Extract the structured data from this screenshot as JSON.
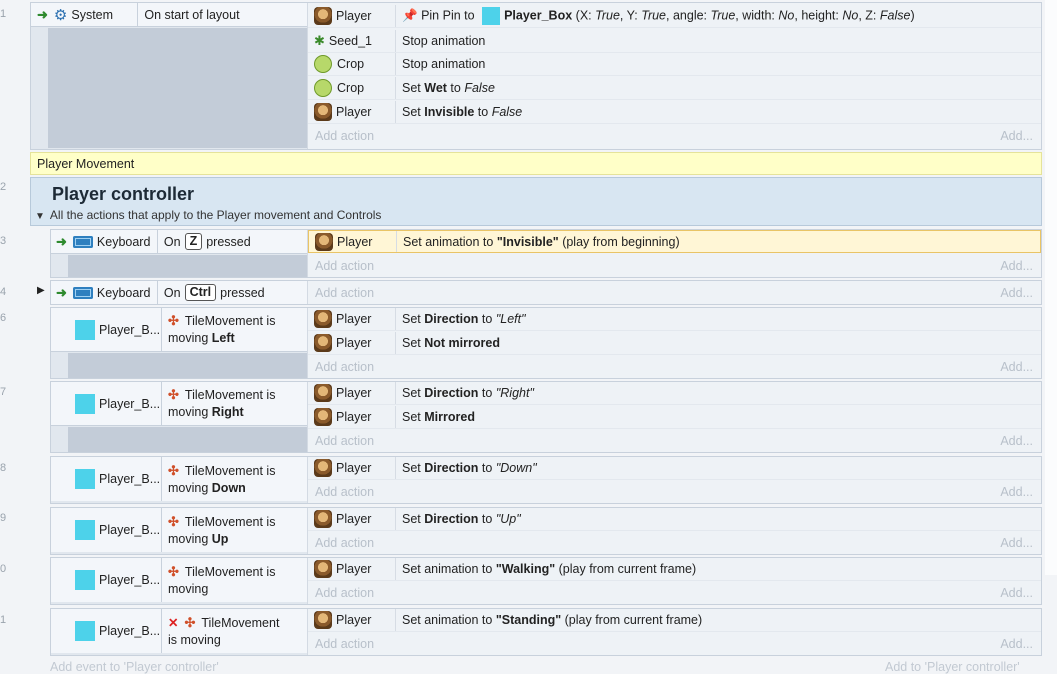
{
  "events": {
    "e1": {
      "line": "1",
      "condition": {
        "object": "System",
        "text": "On start of layout",
        "icon": "gear-icon"
      },
      "actions": [
        {
          "object": "Player",
          "icon": "player-icon",
          "text": "Pin Pin to",
          "target": "Player_Box",
          "params": {
            "open": "(X:",
            "x": "True",
            "y_label": ", Y:",
            "y": "True",
            "angle_label": ", angle:",
            "angle": "True",
            "width_label": ", width:",
            "width": "No",
            "height_label": ", height:",
            "height": "No",
            "z_label": ", Z:",
            "z": "False",
            "close": ")"
          }
        },
        {
          "object": "Seed_1",
          "icon": "seed-icon",
          "text": "Stop animation"
        },
        {
          "object": "Crop",
          "icon": "crop-icon",
          "text": "Stop animation"
        },
        {
          "object": "Crop",
          "icon": "crop-icon",
          "pre": "Set",
          "bold": "Wet",
          "mid": "to",
          "ital": "False"
        },
        {
          "object": "Player",
          "icon": "player-icon",
          "pre": "Set",
          "bold": "Invisible",
          "mid": "to",
          "ital": "False"
        }
      ]
    },
    "comment": "Player Movement",
    "group": {
      "line": "2",
      "title": "Player controller",
      "description": "All the actions that apply to the Player movement and Controls"
    },
    "e3": {
      "line": "3",
      "object": "Keyboard",
      "on": "On",
      "key": "Z",
      "post": "pressed",
      "action_object": "Player",
      "pre": "Set animation to",
      "bold": "\"Invisible\"",
      "post_text": "(play from beginning)"
    },
    "e4": {
      "line": "4",
      "object": "Keyboard",
      "on": "On",
      "key": "Ctrl",
      "post": "pressed"
    },
    "e6": {
      "line": "6",
      "object": "Player_B...",
      "cond_a": "TileMovement is",
      "cond_b": "moving",
      "cond_bold": "Left",
      "a1": {
        "object": "Player",
        "pre": "Set",
        "bold": "Direction",
        "mid": "to",
        "ital": "\"Left\""
      },
      "a2": {
        "object": "Player",
        "pre": "Set",
        "bold": "Not mirrored"
      }
    },
    "e7": {
      "line": "7",
      "object": "Player_B...",
      "cond_a": "TileMovement is",
      "cond_b": "moving",
      "cond_bold": "Right",
      "a1": {
        "object": "Player",
        "pre": "Set",
        "bold": "Direction",
        "mid": "to",
        "ital": "\"Right\""
      },
      "a2": {
        "object": "Player",
        "pre": "Set",
        "bold": "Mirrored"
      }
    },
    "e8": {
      "line": "8",
      "object": "Player_B...",
      "cond_a": "TileMovement is",
      "cond_b": "moving",
      "cond_bold": "Down",
      "a1": {
        "object": "Player",
        "pre": "Set",
        "bold": "Direction",
        "mid": "to",
        "ital": "\"Down\""
      }
    },
    "e9": {
      "line": "9",
      "object": "Player_B...",
      "cond_a": "TileMovement is",
      "cond_b": "moving",
      "cond_bold": "Up",
      "a1": {
        "object": "Player",
        "pre": "Set",
        "bold": "Direction",
        "mid": "to",
        "ital": "\"Up\""
      }
    },
    "e10": {
      "line": "0",
      "object": "Player_B...",
      "cond_a": "TileMovement is",
      "cond_b": "moving",
      "a1": {
        "object": "Player",
        "pre": "Set animation to",
        "bold": "\"Walking\"",
        "post": "(play from current frame)"
      }
    },
    "e11": {
      "line": "1",
      "object": "Player_B...",
      "cond_a": "TileMovement",
      "cond_b": "is moving",
      "a1": {
        "object": "Player",
        "pre": "Set animation to",
        "bold": "\"Standing\"",
        "post": "(play from current frame)"
      }
    }
  },
  "labels": {
    "add_action": "Add action",
    "add_short": "Add...",
    "add_event": "Add event to 'Player controller'",
    "add_to": "Add to 'Player controller'"
  },
  "colors": {
    "selected_row": "#fff6d6",
    "comment_bg": "#ffffc8",
    "group_bg": "#d8e6f2",
    "object_square": "#4dd2ea"
  }
}
